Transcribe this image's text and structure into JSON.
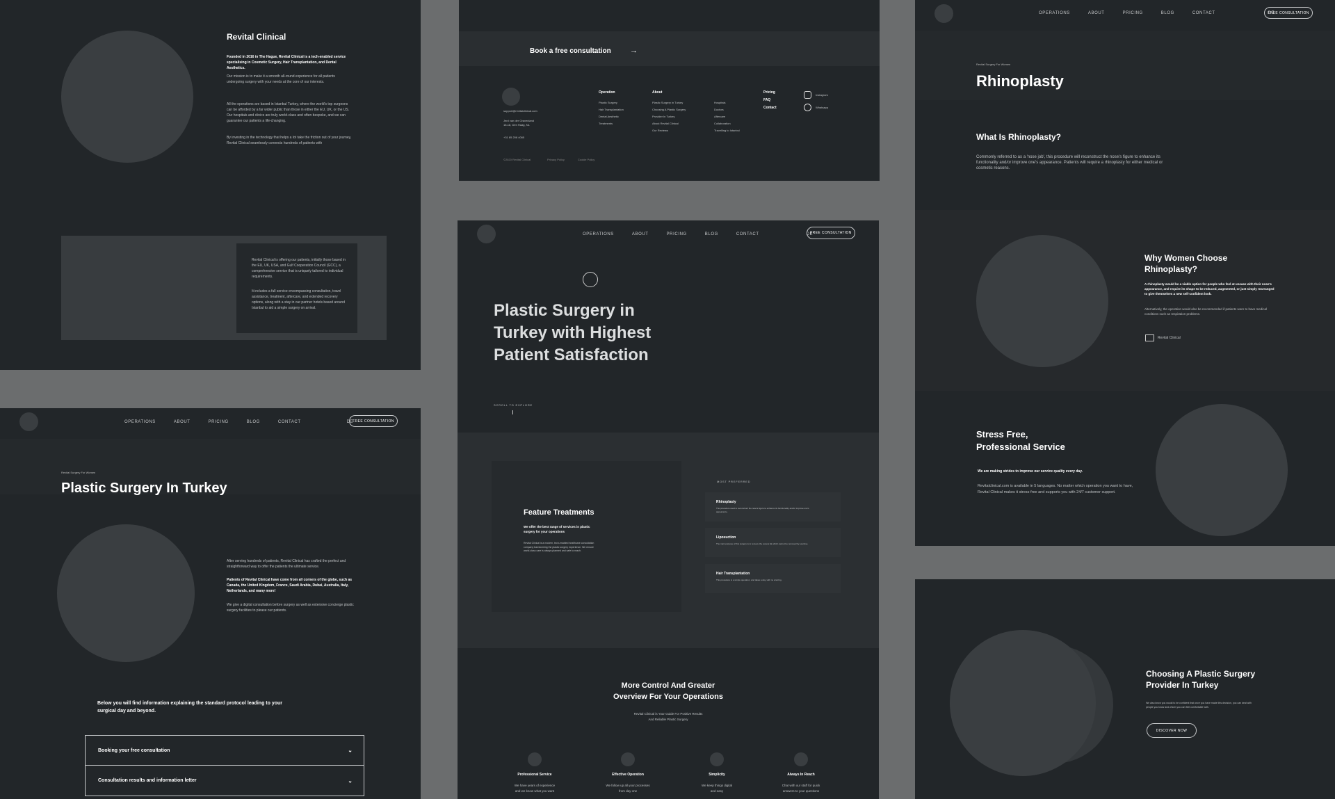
{
  "nav": {
    "operations": "OPERATIONS",
    "about": "ABOUT",
    "pricing": "PRICING",
    "blog": "BLOG",
    "contact": "CONTACT",
    "lang": "DE",
    "cta": "FREE CONSULTATION"
  },
  "about_panel": {
    "title": "Revital Clinical",
    "intro": "Founded in 2016 in The Hague, Revital Clinical is a tech-enabled service specialising in Cosmetic Surgery, Hair Transplantation, and Dental Aesthetics.",
    "mission": "Our mission is to make it a smooth all-round experience for all patients undergoing surgery with your needs at the core of our interests.",
    "para2": "All the operations are based in Istanbul Turkey, where the world's top surgeons can be afforded by a far wider public than those in either the EU, UK, or the US. Our hospitals and clinics are truly world-class and often bespoke, and we can guarantee our patients a life-changing.",
    "para3": "By investing in the technology that helps a lot take the friction out of your journey, Revital Clinical seamlessly connects hundreds of patients with",
    "card_p1": "Revital Clinical is offering our patients, initially those based in the EU, UK, USA, and Gulf Cooperation Council (GCC), a comprehensive service that is uniquely tailored to individual requirements.",
    "card_p2": "It includes a full service encompassing consultation, travel assistance, treatment, aftercare, and extended recovery options, along with a stay in our partner hotels based around Istanbul to aid a simple surgery on arrival."
  },
  "footer_panel": {
    "cta": "Book a free consultation",
    "email": "support@revitalclinical.com",
    "address1": "Jerd van der Gravenland",
    "address2": "16-18, Den Haag, NL",
    "phone": "+31 85 208 4065",
    "col1": {
      "title": "Operation",
      "items": [
        "Plastic Surgery",
        "Hair Transplantation",
        "Dental Aesthetic",
        "Treatments"
      ]
    },
    "col2": {
      "title": "About",
      "items": [
        "Plastic Surgery in Turkey",
        "Choosing A Plastic Surgery",
        "Provider In Turkey",
        "About Revital Clinical",
        "Our Reviews"
      ]
    },
    "col3": {
      "items": [
        "Hospitals",
        "Doctors",
        "Aftercare",
        "Collaboration",
        "Travelling to Istanbul"
      ]
    },
    "col4": {
      "items": [
        "Pricing",
        "FAQ",
        "Contact"
      ]
    },
    "social": [
      "Instagram",
      "Whatsapp"
    ],
    "copyright": "©2020 Revital Clinical",
    "privacy": "Privacy Policy",
    "cookie": "Cookie Policy"
  },
  "hero_panel": {
    "headline1": "Plastic Surgery in",
    "headline2": "Turkey with Highest",
    "headline3": "Patient Satisfaction",
    "scroll": "SCROLL TO EXPLORE",
    "feature_title": "Feature Treatments",
    "feature_sub": "We offer the best range of services in plastic surgery for your operations",
    "feature_body": "Revital Clinical is a modern, tech-enabled healthcare consultation company transforming the plastic surgery experience. We ensure world-class care is always planned and safe to reach.",
    "most_preferred": "MOST PREFERRED",
    "treatments": [
      {
        "name": "Rhinoplasty",
        "desc": "The procedure used to reconstruct the nose's figure to enhance its functionality and/or improve one's appearance."
      },
      {
        "name": "Liposuction",
        "desc": "The main purpose of this surgery is to remove the excess fat which cannot be removed by exercise."
      },
      {
        "name": "Hair Transplantation",
        "desc": "This procedure is a simple operation, and takes a day, with no scarring."
      }
    ],
    "control_title1": "More Control And Greater",
    "control_title2": "Overview For Your Operations",
    "control_sub1": "Revital Clinical is Your Guide For Positive Results",
    "control_sub2": "And Reliable Plastic Surgery",
    "features": [
      {
        "title": "Professional Service",
        "l1": "We have years of experience",
        "l2": "and we know what you want"
      },
      {
        "title": "Effective Operation",
        "l1": "We follow up all your processes",
        "l2": "from day one"
      },
      {
        "title": "Simplicity",
        "l1": "We keep things digital",
        "l2": "and easy"
      },
      {
        "title": "Always In Reach",
        "l1": "Chat with our staff for quick",
        "l2": "answers to your questions"
      }
    ]
  },
  "turkey_panel": {
    "breadcrumb": "Revital Surgery For Women",
    "title": "Plastic Surgery In Turkey",
    "p1": "After serving hundreds of patients, Revital Clinical has crafted the perfect and straightforward way to offer the patients the ultimate service.",
    "p2": "Patients of Revital Clinical have come from all corners of the globe, such as Canada, the United Kingdom, France, Saudi Arabia, Dubai, Australia, Italy, Netherlands, and many more!",
    "p3": "We give a digital consultation before surgery as well as extensive concierge plastic surgery facilities to please our patients.",
    "below": "Below you will find information explaining the standard protocol leading to your surgical day and beyond.",
    "accordion": [
      "Booking your free consultation",
      "Consultation results and information letter"
    ]
  },
  "rhino_panel": {
    "breadcrumb": "Revital Surgery For Women",
    "title": "Rhinoplasty",
    "what_title": "What Is Rhinoplasty?",
    "what_body": "Commonly referred to as a 'nose job', this procedure will reconstruct the nose's figure to enhance its functionality and/or improve one's appearance. Patients will require a rhinoplasty for either medical or cosmetic reasons.",
    "why_title1": "Why Women Choose",
    "why_title2": "Rhinoplasty?",
    "why_body1": "A rhinoplasty would be a viable option for people who feel at unease with their nose's appearance, and require its shape to be reduced, augmented, or just simply rearranged to give themselves a new self-confident look.",
    "why_body2": "Alternatively, the operation would also be recommended if patients were to have medical conditions such as respiration problems.",
    "brand": "Revital Clinical",
    "stress_title1": "Stress Free,",
    "stress_title2": "Professional Service",
    "stress_lead": "We are making strides to improve our service quality every day.",
    "stress_body": "Revitalclinical.com is available in 5 languages. No matter which operation you want to have, Revital Clinical makes it stress-free and supports you with 24/7 customer support."
  },
  "choose_panel": {
    "title1": "Choosing A Plastic Surgery",
    "title2": "Provider In Turkey",
    "body": "We also know you would to be confident that once you have made this decision, you can deal with people you know and whom you can feel comfortable with.",
    "cta": "DISCOVER NOW"
  }
}
